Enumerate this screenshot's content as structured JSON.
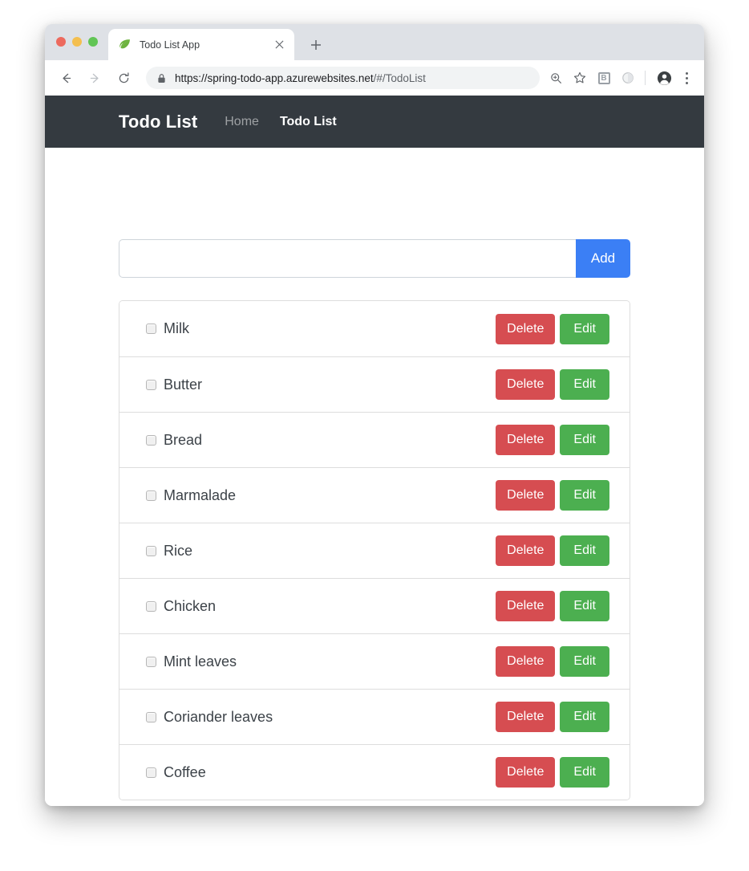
{
  "browser": {
    "tab": {
      "title": "Todo List App",
      "favicon": "spring-leaf-icon",
      "close_icon": "close-icon"
    },
    "new_tab_icon": "plus-icon",
    "nav": {
      "back_icon": "back-arrow-icon",
      "forward_icon": "forward-arrow-icon",
      "reload_icon": "reload-icon"
    },
    "omnibox": {
      "lock_icon": "lock-icon",
      "url_secure": "https://spring-todo-app.azurewebsites.net",
      "url_path": "/#/TodoList",
      "url_full": "https://spring-todo-app.azurewebsites.net/#/TodoList"
    },
    "toolbar_icons": {
      "zoom": "zoom-in-icon",
      "bookmark": "star-icon",
      "extension_b": "B",
      "extension_circle": "circle-icon",
      "profile": "account-avatar-icon",
      "menu": "three-dot-menu-icon"
    }
  },
  "app": {
    "navbar": {
      "brand": "Todo List",
      "links": [
        {
          "label": "Home",
          "active": false
        },
        {
          "label": "Todo List",
          "active": true
        }
      ]
    },
    "add_form": {
      "input_value": "",
      "input_placeholder": "",
      "button_label": "Add"
    },
    "list": {
      "delete_label": "Delete",
      "edit_label": "Edit",
      "items": [
        {
          "label": "Milk",
          "checked": false
        },
        {
          "label": "Butter",
          "checked": false
        },
        {
          "label": "Bread",
          "checked": false
        },
        {
          "label": "Marmalade",
          "checked": false
        },
        {
          "label": "Rice",
          "checked": false
        },
        {
          "label": "Chicken",
          "checked": false
        },
        {
          "label": "Mint leaves",
          "checked": false
        },
        {
          "label": "Coriander leaves",
          "checked": false
        },
        {
          "label": "Coffee",
          "checked": false
        }
      ]
    }
  },
  "colors": {
    "navbar_bg": "#343a40",
    "add_button": "#3b7ff5",
    "delete_button": "#d64d51",
    "edit_button": "#4caf50",
    "tabstrip_bg": "#dee1e6"
  }
}
